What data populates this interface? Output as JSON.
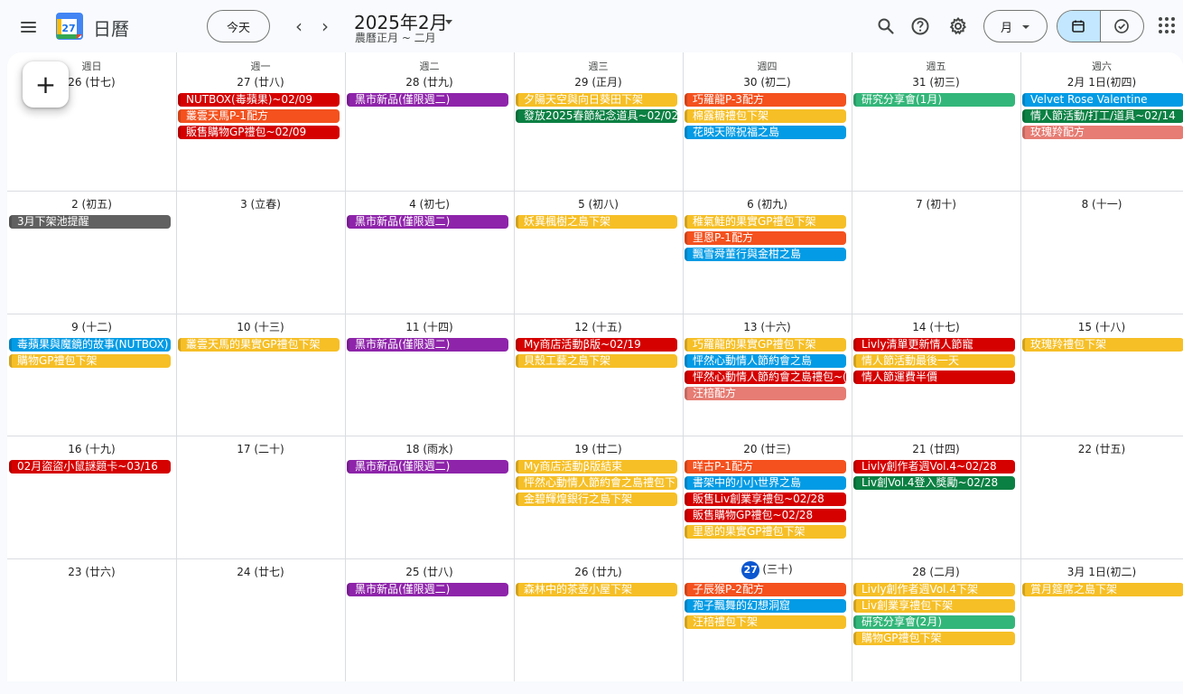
{
  "header": {
    "app_title": "日曆",
    "logo_number": "27",
    "today_button": "今天",
    "prev_icon": "‹",
    "next_icon": "›",
    "month_title": "2025年2月",
    "month_subtitle": "農曆正月 ~ 二月",
    "view_label": "月",
    "icons": [
      "menu-icon",
      "search-icon",
      "help-icon",
      "settings-icon",
      "calendar-icon",
      "task-icon",
      "apps-grid-icon"
    ]
  },
  "create_button": "+",
  "weekdays": [
    "週日",
    "週一",
    "週二",
    "週三",
    "週四",
    "週五",
    "週六"
  ],
  "colors": {
    "red": "#d50000",
    "orange": "#f4511e",
    "yellow": "#f6bf26",
    "blue": "#039be5",
    "purple": "#8e24aa",
    "green": "#0b8043",
    "sage": "#33b679",
    "pink": "#e67c73",
    "gray": "#616161",
    "today": "#0b57d0"
  },
  "weeks": [
    [
      {
        "date": "26 (廿七)",
        "events": []
      },
      {
        "date": "27 (廿八)",
        "events": [
          {
            "t": "NUTBOX(毒蘋果)~02/09",
            "c": "red"
          },
          {
            "t": "叢雲天馬P-1配方",
            "c": "orange"
          },
          {
            "t": "販售購物GP禮包~02/09",
            "c": "red"
          }
        ]
      },
      {
        "date": "28 (廿九)",
        "events": [
          {
            "t": "黑市新品(僅限週二)",
            "c": "purple"
          }
        ]
      },
      {
        "date": "29 (正月)",
        "events": [
          {
            "t": "夕陽天空與向日葵田下架",
            "c": "yellow"
          },
          {
            "t": "發放2025春節紀念道具~02/02",
            "c": "green"
          }
        ]
      },
      {
        "date": "30 (初二)",
        "events": [
          {
            "t": "巧羅龍P-3配方",
            "c": "orange"
          },
          {
            "t": "棉露糖禮包下架",
            "c": "yellow"
          },
          {
            "t": "花映天際祝福之島",
            "c": "blue"
          }
        ]
      },
      {
        "date": "31 (初三)",
        "events": [
          {
            "t": "研究分享會(1月)",
            "c": "sage"
          }
        ]
      },
      {
        "date": "2月 1日(初四)",
        "events": [
          {
            "t": "Velvet Rose Valentine",
            "c": "blue"
          },
          {
            "t": "情人節活動/打工/道具~02/14",
            "c": "green"
          },
          {
            "t": "玫瑰羚配方",
            "c": "pink"
          }
        ]
      }
    ],
    [
      {
        "date": "2 (初五)",
        "events": [
          {
            "t": "3月下架池提醒",
            "c": "gray"
          }
        ]
      },
      {
        "date": "3 (立春)",
        "events": []
      },
      {
        "date": "4 (初七)",
        "events": [
          {
            "t": "黑市新品(僅限週二)",
            "c": "purple"
          }
        ]
      },
      {
        "date": "5 (初八)",
        "events": [
          {
            "t": "妖異楓樹之島下架",
            "c": "yellow"
          }
        ]
      },
      {
        "date": "6 (初九)",
        "events": [
          {
            "t": "稚氣鮭的果實GP禮包下架",
            "c": "yellow"
          },
          {
            "t": "里恩P-1配方",
            "c": "orange"
          },
          {
            "t": "飄雪舜董行與金柑之島",
            "c": "blue"
          }
        ]
      },
      {
        "date": "7 (初十)",
        "events": []
      },
      {
        "date": "8 (十一)",
        "events": []
      }
    ],
    [
      {
        "date": "9 (十二)",
        "events": [
          {
            "t": "毒蘋果與魔鏡的故事(NUTBOX)",
            "c": "blue"
          },
          {
            "t": "購物GP禮包下架",
            "c": "yellow"
          }
        ]
      },
      {
        "date": "10 (十三)",
        "events": [
          {
            "t": "叢雲天馬的果實GP禮包下架",
            "c": "yellow"
          }
        ]
      },
      {
        "date": "11 (十四)",
        "events": [
          {
            "t": "黑市新品(僅限週二)",
            "c": "purple"
          }
        ]
      },
      {
        "date": "12 (十五)",
        "events": [
          {
            "t": "My商店活動β版~02/19",
            "c": "red"
          },
          {
            "t": "貝殼工藝之島下架",
            "c": "yellow"
          }
        ]
      },
      {
        "date": "13 (十六)",
        "events": [
          {
            "t": "巧羅龍的果實GP禮包下架",
            "c": "yellow"
          },
          {
            "t": "怦然心動情人節約會之島",
            "c": "blue"
          },
          {
            "t": "怦然心動情人節約會之島禮包~(",
            "c": "red"
          },
          {
            "t": "汪棓配方",
            "c": "pink"
          }
        ]
      },
      {
        "date": "14 (十七)",
        "events": [
          {
            "t": "Livly清單更新情人節寵",
            "c": "red"
          },
          {
            "t": "情人節活動最後一天",
            "c": "yellow"
          },
          {
            "t": "情人節運費半價",
            "c": "red"
          }
        ]
      },
      {
        "date": "15 (十八)",
        "events": [
          {
            "t": "玫瑰羚禮包下架",
            "c": "yellow"
          }
        ]
      }
    ],
    [
      {
        "date": "16 (十九)",
        "events": [
          {
            "t": "02月盜盜小鼠謎題卡~03/16",
            "c": "red"
          }
        ]
      },
      {
        "date": "17 (二十)",
        "events": []
      },
      {
        "date": "18 (雨水)",
        "events": [
          {
            "t": "黑市新品(僅限週二)",
            "c": "purple"
          }
        ]
      },
      {
        "date": "19 (廿二)",
        "events": [
          {
            "t": "My商店活動β版結束",
            "c": "yellow"
          },
          {
            "t": "怦然心動情人節約會之島禮包下",
            "c": "yellow"
          },
          {
            "t": "金碧輝煌銀行之島下架",
            "c": "yellow"
          }
        ]
      },
      {
        "date": "20 (廿三)",
        "events": [
          {
            "t": "咩古P-1配方",
            "c": "orange"
          },
          {
            "t": "書架中的小小世界之島",
            "c": "blue"
          },
          {
            "t": "販售Liv創業享禮包~02/28",
            "c": "red"
          },
          {
            "t": "販售購物GP禮包~02/28",
            "c": "red"
          },
          {
            "t": "里恩的果實GP禮包下架",
            "c": "yellow"
          }
        ]
      },
      {
        "date": "21 (廿四)",
        "events": [
          {
            "t": "Livly創作者週Vol.4~02/28",
            "c": "red"
          },
          {
            "t": "Liv創Vol.4登入獎勵~02/28",
            "c": "green"
          }
        ]
      },
      {
        "date": "22 (廿五)",
        "events": []
      }
    ],
    [
      {
        "date": "23 (廿六)",
        "events": []
      },
      {
        "date": "24 (廿七)",
        "events": []
      },
      {
        "date": "25 (廿八)",
        "events": [
          {
            "t": "黑市新品(僅限週二)",
            "c": "purple"
          }
        ]
      },
      {
        "date": "26 (廿九)",
        "events": [
          {
            "t": "森林中的茶壺小屋下架",
            "c": "yellow"
          }
        ]
      },
      {
        "date": "(三十)",
        "today": "27",
        "events": [
          {
            "t": "子辰猴P-2配方",
            "c": "orange"
          },
          {
            "t": "孢子飄舞的幻想洞窟",
            "c": "blue"
          },
          {
            "t": "汪棓禮包下架",
            "c": "yellow"
          }
        ]
      },
      {
        "date": "28 (二月)",
        "events": [
          {
            "t": "Livly創作者週Vol.4下架",
            "c": "yellow"
          },
          {
            "t": "Liv創業享禮包下架",
            "c": "yellow"
          },
          {
            "t": "研究分享會(2月)",
            "c": "sage"
          },
          {
            "t": "購物GP禮包下架",
            "c": "yellow"
          }
        ]
      },
      {
        "date": "3月 1日(初二)",
        "events": [
          {
            "t": "賞月筵席之島下架",
            "c": "yellow"
          }
        ]
      }
    ]
  ]
}
